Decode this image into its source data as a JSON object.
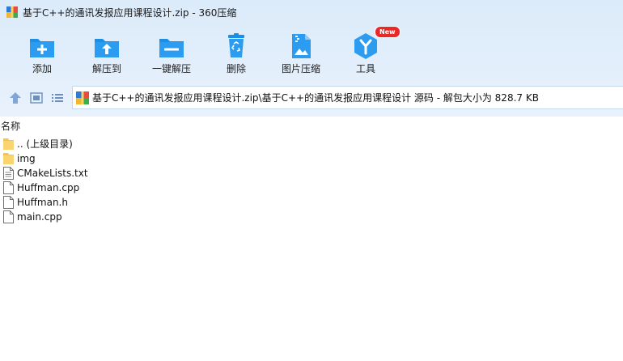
{
  "window": {
    "title": "基于C++的通讯发报应用课程设计.zip - 360压缩",
    "app_icon": "archive-icon"
  },
  "toolbar": {
    "items": [
      {
        "label": "添加",
        "icon": "add-icon"
      },
      {
        "label": "解压到",
        "icon": "extract-to-icon"
      },
      {
        "label": "一键解压",
        "icon": "one-click-extract-icon"
      },
      {
        "label": "删除",
        "icon": "recycle-bin-icon"
      },
      {
        "label": "图片压缩",
        "icon": "image-compress-icon"
      },
      {
        "label": "工具",
        "icon": "tools-icon",
        "badge": "New"
      }
    ]
  },
  "nav": {
    "buttons": [
      "up-icon",
      "view-icon",
      "list-icon"
    ],
    "address": "基于C++的通讯发报应用课程设计.zip\\基于C++的通讯发报应用课程设计 源码 - 解包大小为 828.7 KB"
  },
  "file_list": {
    "column_name": "名称",
    "items": [
      {
        "name": ".. (上级目录)",
        "type": "folder"
      },
      {
        "name": "img",
        "type": "folder"
      },
      {
        "name": "CMakeLists.txt",
        "type": "text-file"
      },
      {
        "name": "Huffman.cpp",
        "type": "file"
      },
      {
        "name": "Huffman.h",
        "type": "file"
      },
      {
        "name": "main.cpp",
        "type": "file"
      }
    ]
  },
  "colors": {
    "accent": "#1c8fe4",
    "badge": "#e8292a",
    "folder": "#f7c350"
  }
}
